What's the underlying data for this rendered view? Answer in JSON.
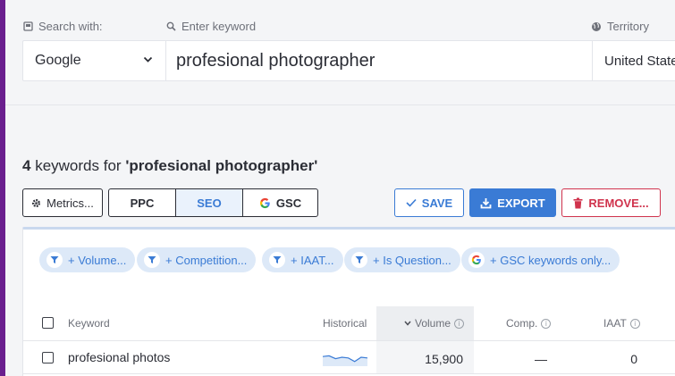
{
  "search": {
    "engine_label": "Search with:",
    "keyword_label": "Enter keyword",
    "territory_label": "Territory",
    "engine_value": "Google",
    "keyword_value": "profesional photographer",
    "territory_value": "United States"
  },
  "summary": {
    "count": "4",
    "text": "keywords for",
    "query": "'profesional photographer'"
  },
  "toolbar": {
    "metrics_label": "Metrics...",
    "ppc_label": "PPC",
    "seo_label": "SEO",
    "gsc_label": "GSC",
    "active_tab": "SEO",
    "save_label": "SAVE",
    "export_label": "EXPORT",
    "remove_label": "REMOVE..."
  },
  "filters": [
    {
      "label": "+ Volume...",
      "icon": "filter-icon"
    },
    {
      "label": "+ Competition...",
      "icon": "filter-icon"
    },
    {
      "label": "+ IAAT...",
      "icon": "filter-icon"
    },
    {
      "label": "+ Is Question...",
      "icon": "filter-icon"
    },
    {
      "label": "+ GSC keywords only...",
      "icon": "google-icon"
    }
  ],
  "table": {
    "columns": {
      "keyword": "Keyword",
      "historical": "Historical",
      "volume": "Volume",
      "comp": "Comp.",
      "iaat": "IAAT"
    },
    "sorted_by": "Volume",
    "rows": [
      {
        "keyword": "profesional photos",
        "volume": "15,900",
        "comp": "—",
        "iaat": "0",
        "historical": [
          0.55,
          0.6,
          0.4,
          0.5,
          0.45,
          0.2,
          0.5,
          0.45
        ]
      }
    ]
  },
  "colors": {
    "accent": "#3a7bd5",
    "danger": "#d0334d",
    "chip_bg": "#dde9f8",
    "sidebar_edge": "#6a1f8e"
  }
}
